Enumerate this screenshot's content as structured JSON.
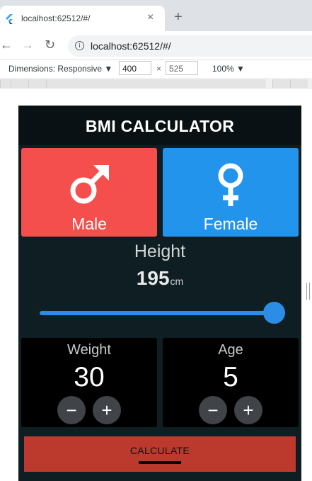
{
  "browser": {
    "tab_title": "localhost:62512/#/",
    "tab_close": "×",
    "new_tab": "+",
    "url": "localhost:62512/#/",
    "nav": {
      "back": "←",
      "forward": "→",
      "reload": "↻"
    },
    "devtools": {
      "dimensions_label": "Dimensions: Responsive ▼",
      "width": "400",
      "times": "×",
      "height": "525",
      "zoom": "100% ▼"
    }
  },
  "app": {
    "title": "BMI CALCULATOR",
    "gender": {
      "male_label": "Male",
      "female_label": "Female",
      "male_icon": "male-symbol-icon",
      "female_icon": "female-symbol-icon"
    },
    "height": {
      "label": "Height",
      "value": "195",
      "unit": "cm",
      "slider_fraction": 1.0
    },
    "weight": {
      "label": "Weight",
      "value": "30"
    },
    "age": {
      "label": "Age",
      "value": "5"
    },
    "stepper": {
      "minus": "−",
      "plus": "+"
    },
    "calculate_label": "CALCULATE",
    "colors": {
      "male_card": "#f44f4c",
      "female_card": "#2394ec",
      "background": "#0f1e22",
      "slider": "#2b8de6",
      "calculate_button": "#bb392d"
    }
  }
}
